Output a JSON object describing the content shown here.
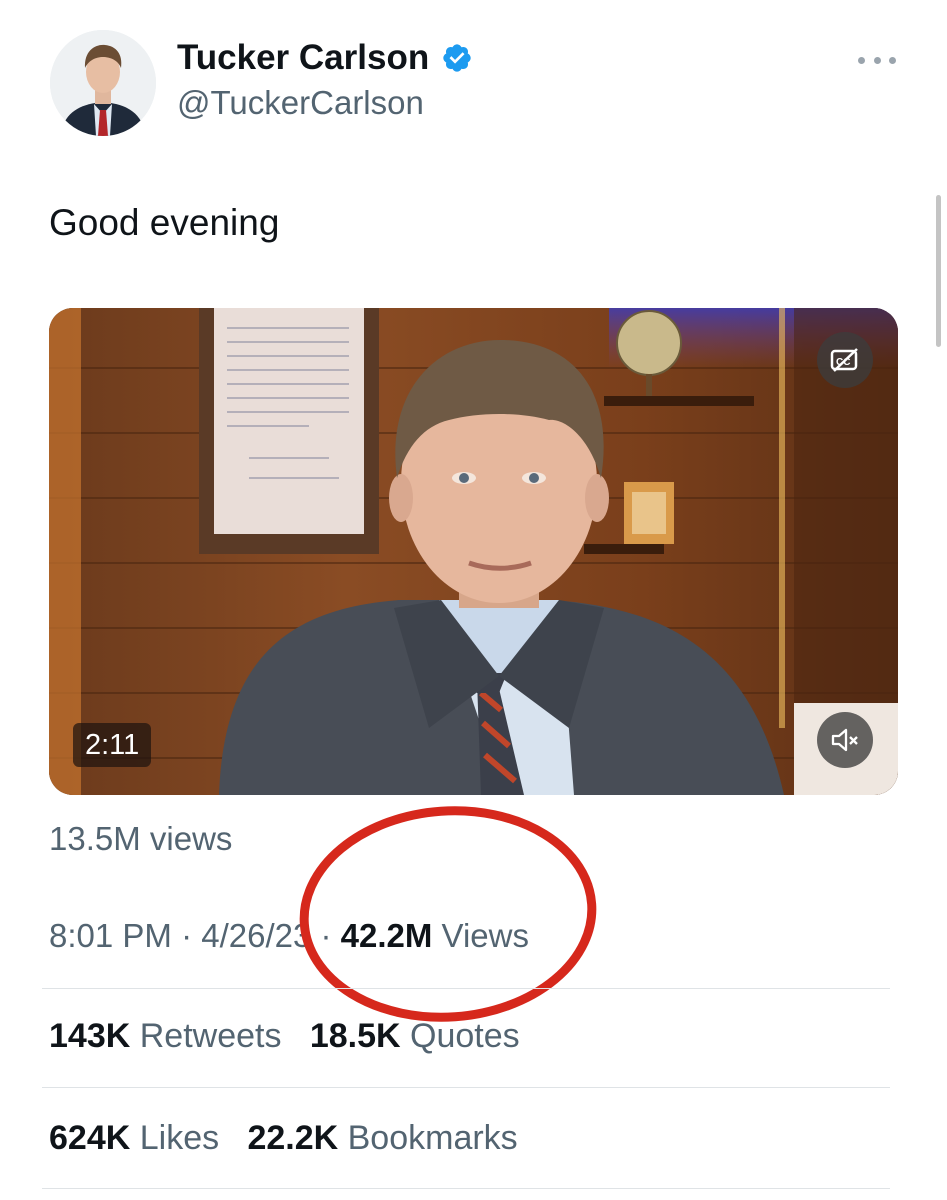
{
  "user": {
    "display_name": "Tucker Carlson",
    "handle": "@TuckerCarlson",
    "verified": true,
    "avatar_icon": "profile-photo",
    "more_icon": "more-dots-icon"
  },
  "tweet": {
    "text": "Good evening"
  },
  "media": {
    "type": "video",
    "duration": "2:11",
    "cc_icon": "closed-captions-off-icon",
    "mute_icon": "muted-speaker-icon"
  },
  "video_views": "13.5M views",
  "meta": {
    "time": "8:01 PM",
    "separator": " · ",
    "date": "4/26/23",
    "views_count": "42.2M",
    "views_label": " Views"
  },
  "stats": {
    "retweets_count": "143K",
    "retweets_label": " Retweets",
    "quotes_count": "18.5K",
    "quotes_label": " Quotes",
    "likes_count": "624K",
    "likes_label": " Likes",
    "bookmarks_count": "22.2K",
    "bookmarks_label": " Bookmarks"
  },
  "colors": {
    "text_primary": "#0f1419",
    "text_secondary": "#536471",
    "verified_blue": "#1d9bf0",
    "annotation_red": "#d6281c"
  }
}
